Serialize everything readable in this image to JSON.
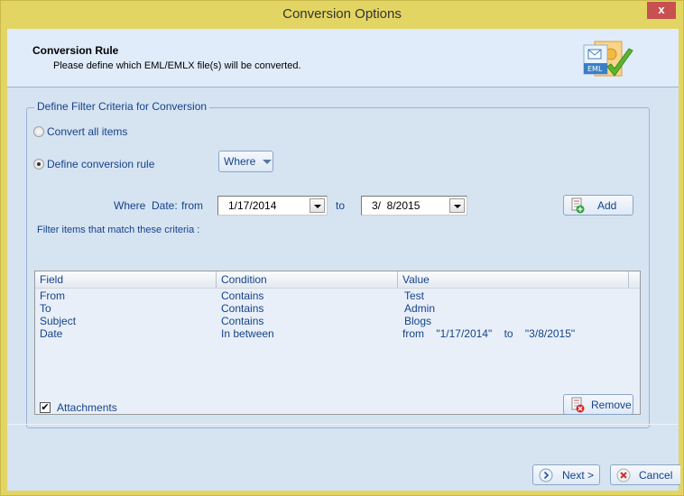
{
  "window": {
    "title": "Conversion Options",
    "close_label": "x"
  },
  "header": {
    "title": "Conversion Rule",
    "subtitle": "Please define which EML/EMLX file(s) will be converted.",
    "icon_label": "EML"
  },
  "filter_group": {
    "legend": "Define Filter Criteria for Conversion",
    "options": [
      {
        "label": "Convert all items",
        "checked": false
      },
      {
        "label": "Define conversion rule",
        "checked": true
      }
    ],
    "where_dropdown": "Where",
    "date_row": {
      "where_label": "Where",
      "date_label": "Date:",
      "from_label": "from",
      "from_value": "1/17/2014",
      "to_label": "to",
      "to_value": "3/  8/2015"
    },
    "add_button": "Add",
    "criteria_label": "Filter items that match these criteria :",
    "table": {
      "columns": [
        "Field",
        "Condition",
        "Value"
      ],
      "rows": [
        [
          "From",
          "Contains",
          "Test"
        ],
        [
          "To",
          "Contains",
          "Admin"
        ],
        [
          "Subject",
          "Contains",
          "Blogs"
        ],
        [
          "Date",
          "In between",
          "from    \"1/17/2014\"    to    \"3/8/2015\""
        ]
      ]
    },
    "attachments": {
      "label": "Attachments",
      "checked": true
    },
    "remove_button": "Remove"
  },
  "footer": {
    "next_button": "Next >",
    "cancel_button": "Cancel"
  }
}
